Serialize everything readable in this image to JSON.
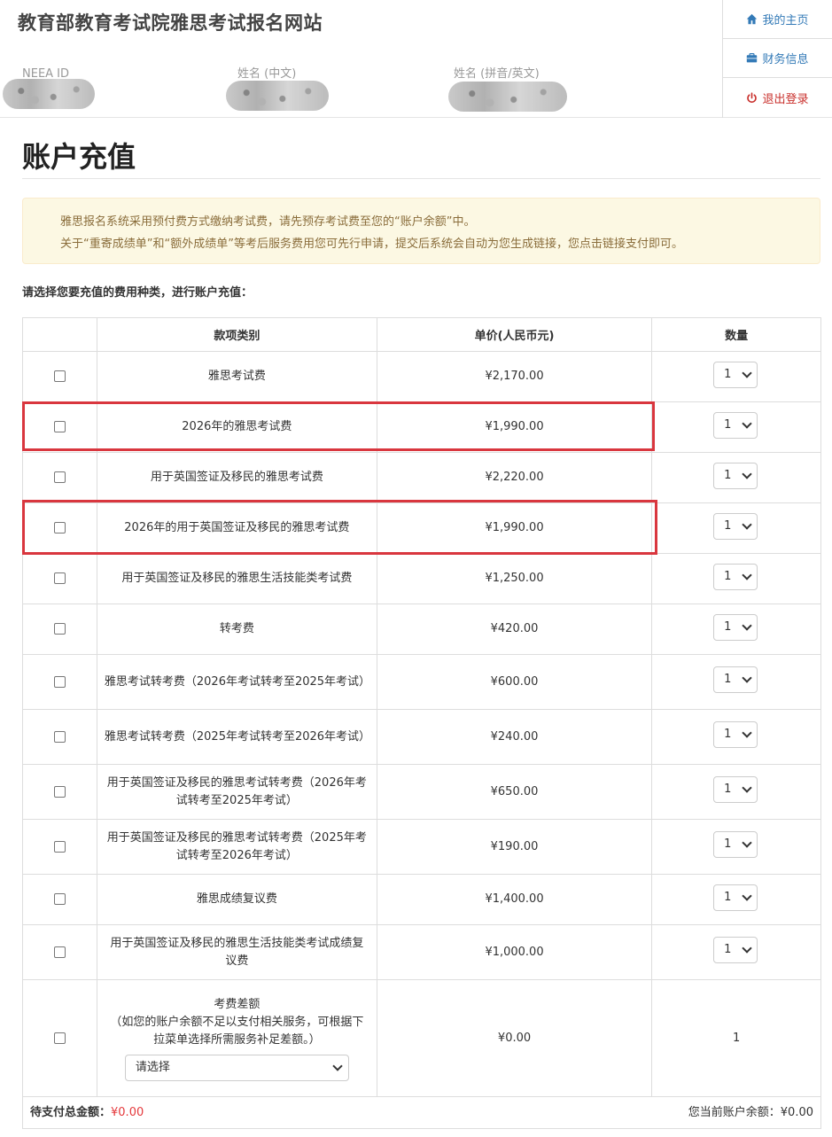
{
  "header": {
    "site_title": "教育部教育考试院雅思考试报名网站",
    "fields": [
      {
        "label": "NEEA ID"
      },
      {
        "label": "姓名 (中文)"
      },
      {
        "label": "姓名 (拼音/英文)"
      }
    ]
  },
  "nav": {
    "home": "我的主页",
    "finance": "财务信息",
    "logout": "退出登录"
  },
  "page": {
    "title": "账户充值",
    "notice_line1": "雅思报名系统采用预付费方式缴纳考试费，请先预存考试费至您的“账户余额”中。",
    "notice_line2": "关于“重寄成绩单”和“额外成绩单”等考后服务费用您可先行申请，提交后系统会自动为您生成链接，您点击链接支付即可。",
    "instruction": "请选择您要充值的费用种类，进行账户充值："
  },
  "table": {
    "headers": [
      "款项类别",
      "单价(人民币元)",
      "数量"
    ],
    "rows": [
      {
        "name": "雅思考试费",
        "price": "¥2,170.00",
        "qty": "1"
      },
      {
        "name": "2026年的雅思考试费",
        "price": "¥1,990.00",
        "qty": "1"
      },
      {
        "name": "用于英国签证及移民的雅思考试费",
        "price": "¥2,220.00",
        "qty": "1"
      },
      {
        "name": "2026年的用于英国签证及移民的雅思考试费",
        "price": "¥1,990.00",
        "qty": "1"
      },
      {
        "name": "用于英国签证及移民的雅思生活技能类考试费",
        "price": "¥1,250.00",
        "qty": "1"
      },
      {
        "name": "转考费",
        "price": "¥420.00",
        "qty": "1"
      },
      {
        "name": "雅思考试转考费（2026年考试转考至2025年考试）",
        "price": "¥600.00",
        "qty": "1"
      },
      {
        "name": "雅思考试转考费（2025年考试转考至2026年考试）",
        "price": "¥240.00",
        "qty": "1"
      },
      {
        "name": "用于英国签证及移民的雅思考试转考费（2026年考试转考至2025年考试）",
        "price": "¥650.00",
        "qty": "1"
      },
      {
        "name": "用于英国签证及移民的雅思考试转考费（2025年考试转考至2026年考试）",
        "price": "¥190.00",
        "qty": "1"
      },
      {
        "name": "雅思成绩复议费",
        "price": "¥1,400.00",
        "qty": "1"
      },
      {
        "name": "用于英国签证及移民的雅思生活技能类考试成绩复议费",
        "price": "¥1,000.00",
        "qty": "1"
      }
    ],
    "balance_row": {
      "name": "考费差额",
      "note": "（如您的账户余额不足以支付相关服务，可根据下拉菜单选择所需服务补足差额。）",
      "select_placeholder": "请选择",
      "price": "¥0.00",
      "qty": "1"
    },
    "footer": {
      "total_label": "待支付总金额：",
      "total_value": "¥0.00",
      "balance_label": "您当前账户余额：",
      "balance_value": "¥0.00"
    }
  },
  "colors": {
    "price_red": "#e4393c",
    "highlight_red": "#d9363e",
    "notice_bg": "#fcf8e3",
    "link_blue": "#337ab7"
  }
}
